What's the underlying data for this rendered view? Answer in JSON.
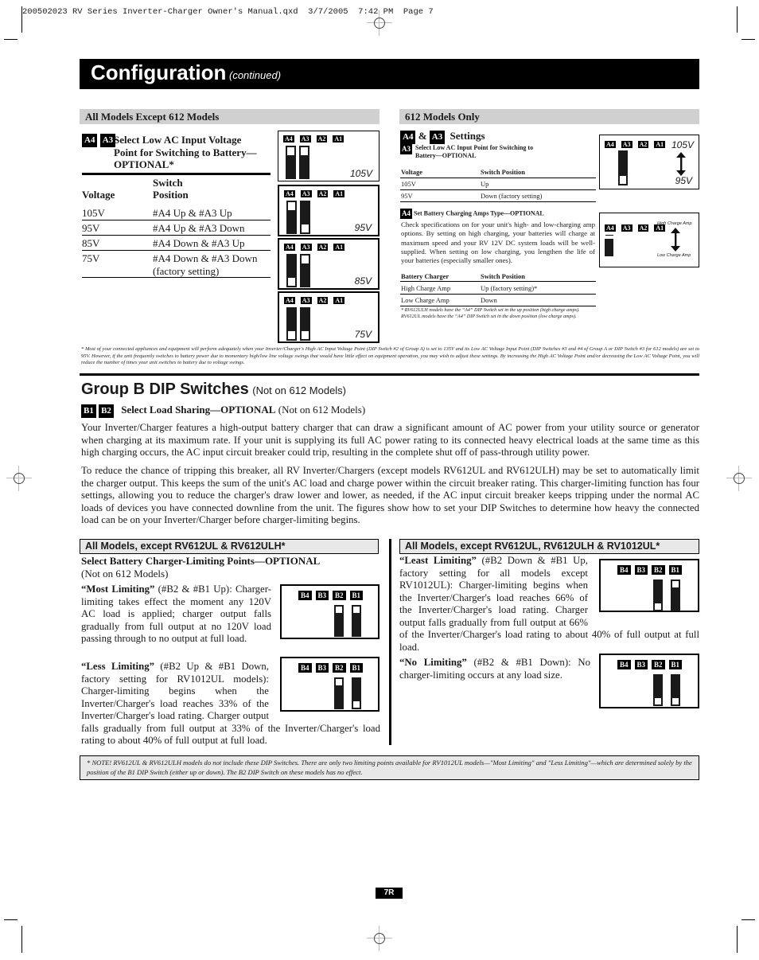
{
  "header": {
    "slug": "200502023 RV Series Inverter-Charger Owner's Manual.qxd  3/7/2005  7:42 PM  Page 7"
  },
  "banner": {
    "title": "Configuration",
    "subtitle": "(continued)"
  },
  "left_section": {
    "bar_title": "All Models Except 612 Models",
    "tags": [
      "A4",
      "A3"
    ],
    "heading": "Select Low AC Input Voltage Point for Switching to Battery— OPTIONAL*",
    "heading_lines": [
      "Select Low AC Input Voltage",
      "Point for Switching to Battery—",
      "OPTIONAL*"
    ],
    "col_voltage": "Voltage",
    "col_switch_1": "Switch",
    "col_switch_2": "Position",
    "rows": [
      {
        "voltage": "105V",
        "position": "#A4 Up & #A3 Up"
      },
      {
        "voltage": "95V",
        "position": "#A4 Up & #A3 Down"
      },
      {
        "voltage": "85V",
        "position": "#A4 Down & #A3 Up"
      },
      {
        "voltage": "75V",
        "position": "#A4 Down & #A3 Down",
        "position2": "(factory setting)"
      }
    ],
    "diagrams": [
      {
        "labels": [
          "A4",
          "A3",
          "A2",
          "A1"
        ],
        "value": "105V",
        "A4": "up",
        "A3": "up"
      },
      {
        "labels": [
          "A4",
          "A3",
          "A2",
          "A1"
        ],
        "value": "95V",
        "A4": "up",
        "A3": "down"
      },
      {
        "labels": [
          "A4",
          "A3",
          "A2",
          "A1"
        ],
        "value": "85V",
        "A4": "down",
        "A3": "up"
      },
      {
        "labels": [
          "A4",
          "A3",
          "A2",
          "A1"
        ],
        "value": "75V",
        "A4": "down",
        "A3": "down"
      }
    ]
  },
  "right_section": {
    "bar_title": "612 Models Only",
    "settings_tag_a": "A4",
    "settings_amp": "&",
    "settings_tag_b": "A3",
    "settings_title": "Settings",
    "a3_tag": "A3",
    "a3_heading_1": "Select Low AC Input Point for Switching to",
    "a3_heading_2": "Battery—OPTIONAL",
    "t1_col1": "Voltage",
    "t1_col2": "Switch Position",
    "t1_rows": [
      {
        "c1": "105V",
        "c2": "Up"
      },
      {
        "c1": "95V",
        "c2": "Down (factory setting)"
      }
    ],
    "a4_tag": "A4",
    "a4_heading": "Set Battery Charging Amps Type—OPTIONAL",
    "a4_text": "Check specifications on for your unit's high- and low-charging amp options. By setting on high charging, your batteries will charge at maximum speed and your RV 12V DC system loads will be well-supplied. When setting on low charging, you lengthen the life of your batteries (especially smaller ones).",
    "t2_col1": "Battery Charger",
    "t2_col2": "Switch Position",
    "t2_rows": [
      {
        "c1": "High Charge Amp",
        "c2": "Up (factory setting)*"
      },
      {
        "c1": "Low Charge Amp",
        "c2": "Down"
      }
    ],
    "t2_note": "* RV612ULH models have the “A4” DIP Switch set in the up position (high charge amps). RV612UL models have the “A4” DIP Switch set in the down position (low charge amps).",
    "diagram_a3": {
      "labels": [
        "A4",
        "A3",
        "A2",
        "A1"
      ],
      "top": "105V",
      "bottom": "95V"
    },
    "diagram_a4": {
      "labels": [
        "A4",
        "A3",
        "A2",
        "A1"
      ],
      "top": "High Charge Amp",
      "bottom": "Low Charge Amp"
    }
  },
  "footnote_a": "* Most of your connected appliances and equipment will perform adequately when your Inverter/Charger's High AC Input Voltage Point (DIP Switch #2 of Group A) is set to 135V and its Low AC Voltage Input Point (DIP Switches #3 and #4 of Group A or DIP Switch #3 for 612 models) are set to 95V. However, if the unit frequently switches to battery power due to momentary high/low line voltage swings that would have little effect on equipment operation, you may wish to adjust these settings. By increasing the High AC Voltage Point and/or decreasing the Low AC Voltage Point, you will reduce the number of times your unit switches to battery due to voltage swings.",
  "group_b": {
    "title": "Group B DIP Switches",
    "title_note": "(Not on 612 Models)",
    "tags": [
      "B1",
      "B2"
    ],
    "subheading": "Select Load Sharing—OPTIONAL",
    "subheading_note": "(Not on 612 Models)",
    "para1": "Your Inverter/Charger features a high-output battery charger that can draw a significant amount of AC power from your utility source or generator when charging at its maximum rate. If your unit is supplying its full AC power rating to its connected heavy electrical loads at the same time as this high charging occurs, the AC input circuit breaker could trip, resulting in the complete shut off of pass-through utility power.",
    "para2": "To reduce the chance of tripping this breaker, all RV Inverter/Chargers (except models RV612UL and RV612ULH) may be set to automatically limit the charger output. This keeps the sum of the unit's AC load and charge power within the circuit breaker rating. This charger-limiting function has four settings, allowing you to reduce the charger's draw lower and lower, as needed, if the AC input circuit breaker keeps tripping under the normal AC loads of devices you have connected downline from the unit. The figures show how to set your DIP Switches to determine how heavy the connected load can be on your Inverter/Charger before charger-limiting begins."
  },
  "left_b": {
    "bar_title": "All Models, except RV612UL & RV612ULH*",
    "heading": "Select Battery Charger-Limiting Points—OPTIONAL",
    "heading_note": "(Not on 612 Models)",
    "most_title": "“Most Limiting”",
    "most_text": " (#B2 & #B1 Up): Charger-limiting takes effect the moment any 120V AC load is applied; charger output falls gradually from full output at no 120V load passing through to no output at full load.",
    "less_title": "“Less Limiting”",
    "less_text": " (#B2 Up & #B1 Down, factory setting for RV1012UL models): Charger-limiting begins when the Inverter/Charger's load reaches 33% of the Inverter/Charger's load rating. Charger output falls gradually from full output at 33% of the Inverter/Charger's load rating to about 40% of full output at full load."
  },
  "right_b": {
    "bar_title": "All Models, except RV612UL, RV612ULH & RV1012UL*",
    "least_title": "“Least Limiting”",
    "least_text": " (#B2 Down & #B1 Up, factory setting for all models except RV1012UL): Charger-limiting begins when the Inverter/Charger's load reaches 66% of the Inverter/Charger's load rating. Charger output falls gradually from full output at 66% of the Inverter/Charger's load rating to about 40% of full output at full load.",
    "none_title": "“No Limiting”",
    "none_text": " (#B2 & #B1 Down): No charger-limiting occurs at any load size."
  },
  "b_diagrams": [
    {
      "setting": "Most Limiting",
      "labels": [
        "B4",
        "B3",
        "B2",
        "B1"
      ],
      "B2": "up",
      "B1": "up"
    },
    {
      "setting": "Less Limiting",
      "labels": [
        "B4",
        "B3",
        "B2",
        "B1"
      ],
      "B2": "up",
      "B1": "down"
    },
    {
      "setting": "Least Limiting",
      "labels": [
        "B4",
        "B3",
        "B2",
        "B1"
      ],
      "B2": "down",
      "B1": "up"
    },
    {
      "setting": "No Limiting",
      "labels": [
        "B4",
        "B3",
        "B2",
        "B1"
      ],
      "B2": "down",
      "B1": "down"
    }
  ],
  "note_box": "* NOTE! RV612UL & RV612ULH models do not include these DIP Switches. There are only two limiting points available for RV1012UL models—\"Most Limiting\" and \"Less Limiting\"—which are determined solely by the position of the B1 DIP Switch (either up or down). The B2 DIP Switch on these models has no effect.",
  "page_number": "7R"
}
